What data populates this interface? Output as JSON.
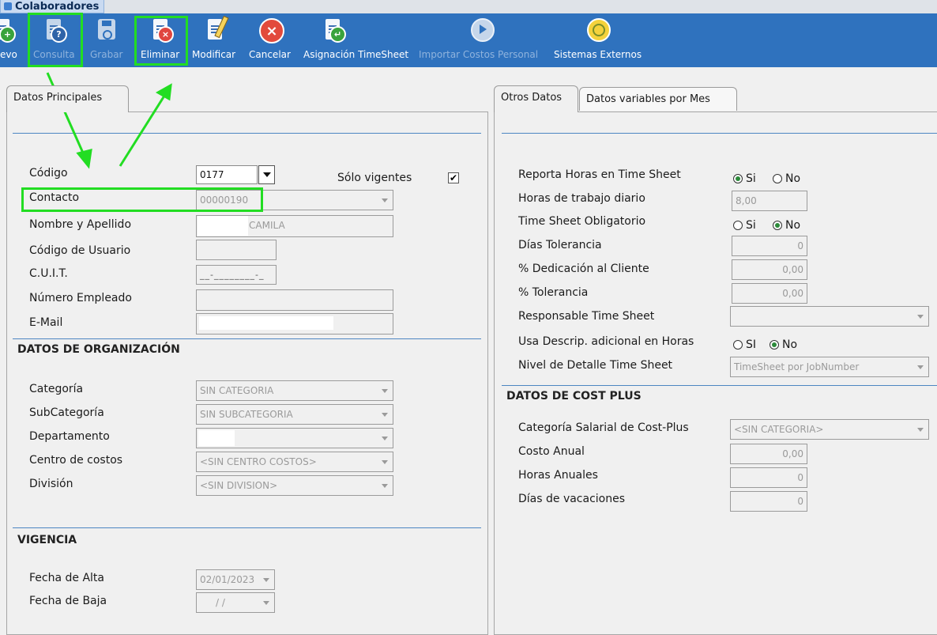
{
  "window": {
    "title": "Colaboradores"
  },
  "toolbar": {
    "nuevo": "evo",
    "consulta": "Consulta",
    "grabar": "Grabar",
    "eliminar": "Eliminar",
    "modificar": "Modificar",
    "cancelar": "Cancelar",
    "asignacion": "Asignación TimeSheet",
    "importar": "Importar Costos Personal",
    "sistemas": "Sistemas Externos"
  },
  "left": {
    "tab": "Datos Principales",
    "codigo_label": "Código",
    "codigo_value": "0177",
    "solo_vigentes_label": "Sólo vigentes",
    "solo_vigentes_check": "✔",
    "contacto_label": "Contacto",
    "contacto_value": "00000190",
    "nombre_label": "Nombre y Apellido",
    "nombre_value": "CAMILA",
    "usuario_label": "Código de Usuario",
    "cuit_label": "C.U.I.T.",
    "cuit_mask": "__-________-_",
    "empleado_label": "Número Empleado",
    "email_label": "E-Mail",
    "org_title": "DATOS DE ORGANIZACIÓN",
    "categoria_label": "Categoría",
    "categoria_value": "SIN CATEGORIA",
    "subcategoria_label": "SubCategoría",
    "subcategoria_value": "SIN SUBCATEGORIA",
    "departamento_label": "Departamento",
    "centro_label": "Centro de costos",
    "centro_value": "<SIN CENTRO COSTOS>",
    "division_label": "División",
    "division_value": "<SIN DIVISION>",
    "vigencia_title": "VIGENCIA",
    "alta_label": "Fecha de Alta",
    "alta_value": "02/01/2023",
    "baja_label": "Fecha de Baja",
    "baja_value": "/ /"
  },
  "right": {
    "tab_otros": "Otros Datos",
    "tab_variables": "Datos variables por Mes",
    "reporta_label": "Reporta Horas en Time Sheet",
    "si": "Si",
    "no": "No",
    "si_upper": "SI",
    "horas_label": "Horas de trabajo diario",
    "horas_value": "8,00",
    "obligatorio_label": "Time Sheet Obligatorio",
    "tolerancia_dias_label": "Días Tolerancia",
    "tolerancia_dias_value": "0",
    "dedicacion_label": "% Dedicación al Cliente",
    "dedicacion_value": "0,00",
    "tolerancia_label": "% Tolerancia",
    "tolerancia_value": "0,00",
    "responsable_label": "Responsable Time Sheet",
    "descrip_label": "Usa Descrip. adicional en Horas",
    "nivel_label": "Nivel de Detalle Time Sheet",
    "nivel_value": "TimeSheet por JobNumber",
    "cost_title": "DATOS DE COST PLUS",
    "cat_salarial_label": "Categoría Salarial de Cost-Plus",
    "cat_salarial_value": "<SIN CATEGORIA>",
    "costo_label": "Costo Anual",
    "costo_value": "0,00",
    "horas_anuales_label": "Horas Anuales",
    "horas_anuales_value": "0",
    "vacaciones_label": "Días de vacaciones",
    "vacaciones_value": "0"
  },
  "colors": {
    "toolbar": "#2f72be",
    "highlight": "#22dd22",
    "section_line": "#4d86c2"
  }
}
